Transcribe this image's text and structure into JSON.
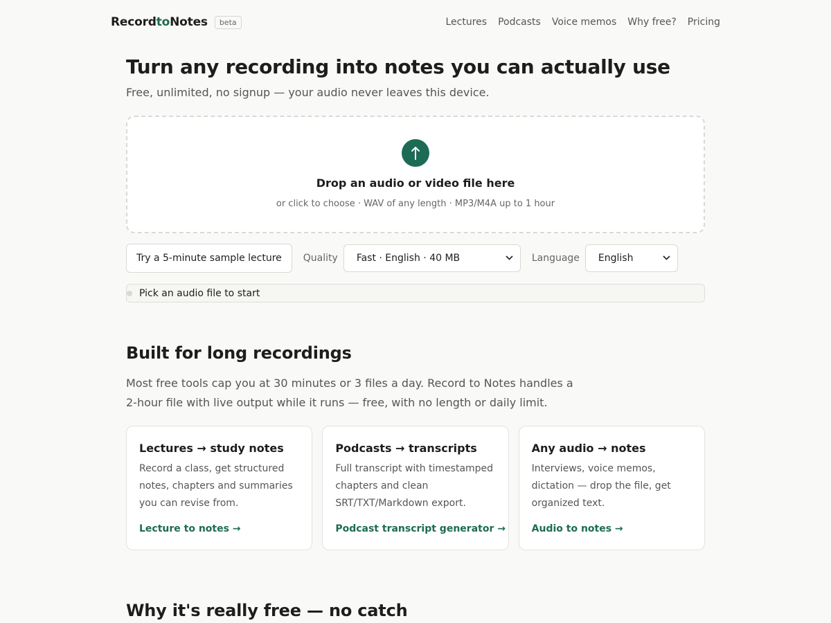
{
  "header": {
    "logo_part1": "Record",
    "logo_part2": "to",
    "logo_part3": "Notes",
    "badge": "beta",
    "nav": [
      "Lectures",
      "Podcasts",
      "Voice memos",
      "Why free?",
      "Pricing"
    ]
  },
  "hero": {
    "title": "Turn any recording into notes you can actually use",
    "subtitle": "Free, unlimited, no signup — your audio never leaves this device."
  },
  "dropzone": {
    "icon": "upload-arrow-icon",
    "title": "Drop an audio or video file here",
    "hint": "or click to choose · WAV of any length · MP3/M4A up to 1 hour"
  },
  "controls": {
    "sample_button": "Try a 5-minute sample lecture",
    "quality_label": "Quality",
    "quality_value": "Fast · English · 40 MB",
    "language_label": "Language",
    "language_value": "English"
  },
  "status": {
    "text": "Pick an audio file to start"
  },
  "section_long": {
    "title": "Built for long recordings",
    "body_line1": "Most free tools cap you at 30 minutes or 3 files a day. Record to Notes handles a",
    "body_line2": "2-hour file with live output while it runs — free, with no length or daily limit."
  },
  "cards": [
    {
      "title": "Lectures → study notes",
      "body": "Record a class, get structured notes, chapters and summaries you can revise from.",
      "link": "Lecture to notes →"
    },
    {
      "title": "Podcasts → transcripts",
      "body": "Full transcript with timestamped chapters and clean SRT/TXT/Markdown export.",
      "link": "Podcast transcript generator →"
    },
    {
      "title": "Any audio → notes",
      "body": "Interviews, voice memos, dictation — drop the file, get organized text.",
      "link": "Audio to notes →"
    }
  ],
  "section_free": {
    "title": "Why it's really free — no catch"
  },
  "colors": {
    "accent": "#1d6b55",
    "background": "#f9f9f7"
  }
}
